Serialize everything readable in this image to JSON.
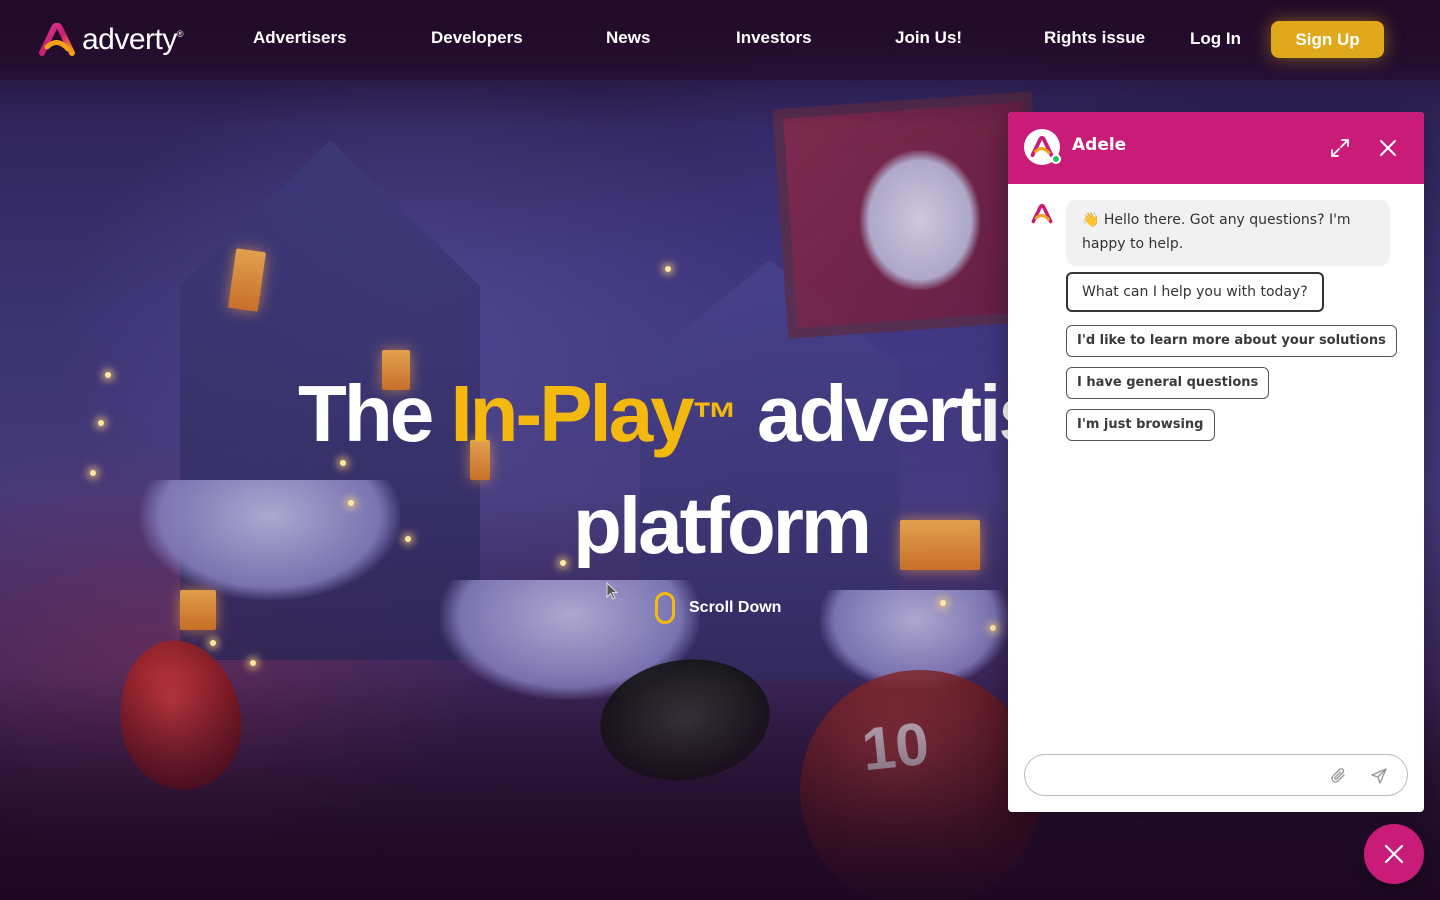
{
  "brand": {
    "name": "adverty",
    "registered_mark": "®",
    "accent_pink": "#c81c78",
    "accent_yellow": "#f4b90f",
    "signup_color": "#e0a81c"
  },
  "nav": {
    "links": [
      "Advertisers",
      "Developers",
      "News",
      "Investors",
      "Join Us!",
      "Rights issue"
    ],
    "login_label": "Log In",
    "signup_label": "Sign Up"
  },
  "hero": {
    "headline_prefix": "The ",
    "headline_accent": "In-Play",
    "headline_tm": "™",
    "headline_suffix": " advertising",
    "headline_line2": "platform",
    "scroll_label": "Scroll Down",
    "ball_number": "10"
  },
  "chat": {
    "agent_name": "Adele",
    "greeting": "👋 Hello there. Got any questions? I'm happy to help.",
    "question": "What can I help you with today?",
    "quick_replies": [
      "I'd like to learn more about your solutions",
      "I have general questions",
      "I'm just browsing"
    ],
    "input_placeholder": "",
    "icons": {
      "expand": "expand-icon",
      "close": "close-icon",
      "attach": "paperclip-icon",
      "send": "send-icon",
      "toggle": "close-icon"
    }
  }
}
